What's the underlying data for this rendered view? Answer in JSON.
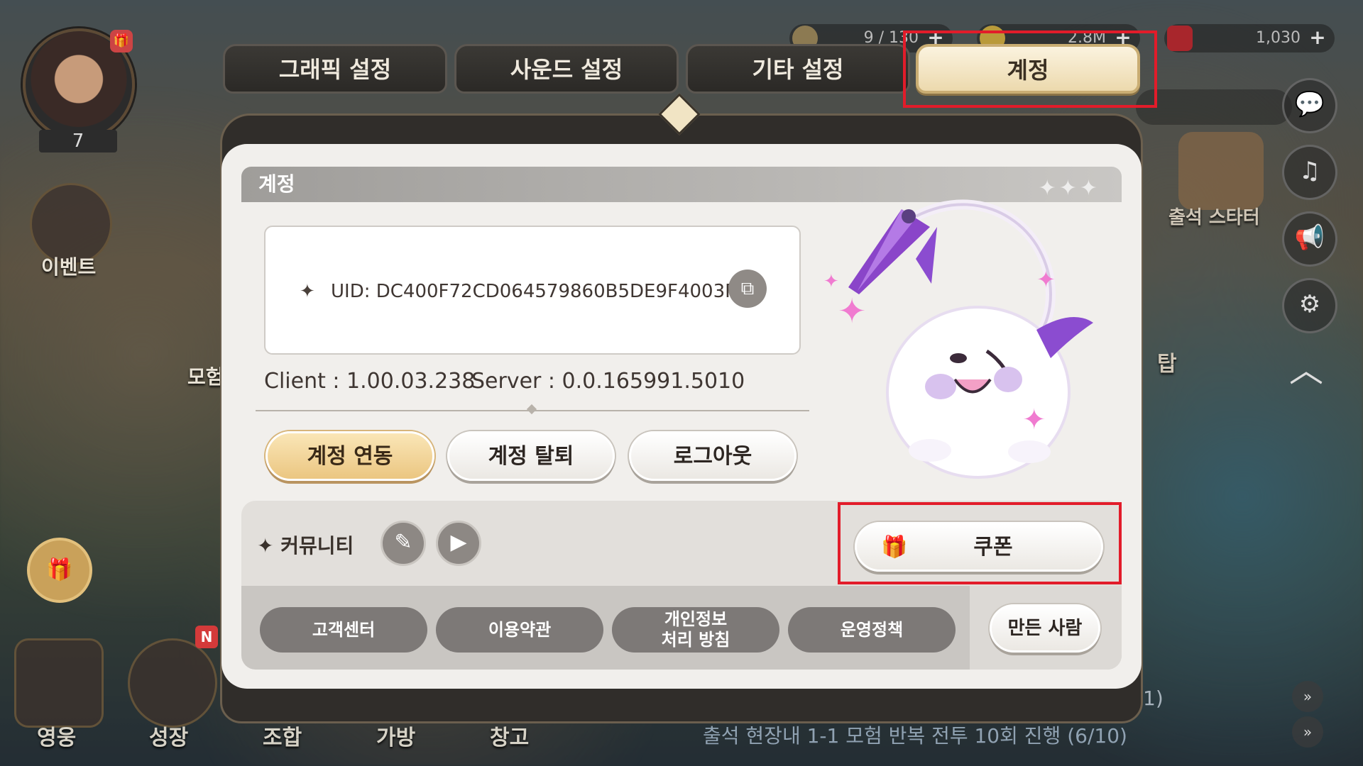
{
  "hud": {
    "level": "7",
    "side_event_label": "이벤트",
    "side_adventure_label": "모험",
    "bottom_nav": [
      "영웅",
      "성장",
      "조합",
      "가방",
      "창고"
    ],
    "currency": [
      {
        "value": "9 / 130"
      },
      {
        "value": "2.8M"
      },
      {
        "value": "1,030"
      }
    ],
    "right_buttons": [
      "chat",
      "music",
      "announce",
      "settings",
      "collapse"
    ],
    "starter_label": "출석 스타터",
    "tower_label": "탑",
    "quest_text": "출석 현장내 1-1 모험 반복 전투 10회 진행 (6/10)",
    "quest_progress": "1)"
  },
  "tabs": [
    {
      "label": "그래픽 설정",
      "active": false
    },
    {
      "label": "사운드 설정",
      "active": false
    },
    {
      "label": "기타 설정",
      "active": false
    },
    {
      "label": "계정",
      "active": true
    }
  ],
  "account": {
    "section_title": "계정",
    "uid_text": "UID: DC400F72CD064579860B5DE9F4003FED",
    "client_version": "Client : 1.00.03.238",
    "server_version": "Server : 0.0.165991.5010",
    "buttons": {
      "link": "계정 연동",
      "withdraw": "계정 탈퇴",
      "logout": "로그아웃"
    },
    "community_label": "커뮤니티",
    "coupon_label": "쿠폰",
    "footer_buttons": [
      "고객센터",
      "이용약관",
      "개인정보\n처리 방침",
      "운영정책"
    ],
    "credits_label": "만든 사람"
  },
  "colors": {
    "highlight": "#e21c2a",
    "active_tab": "#ecd9ad",
    "gold_button": "#ebc681"
  }
}
